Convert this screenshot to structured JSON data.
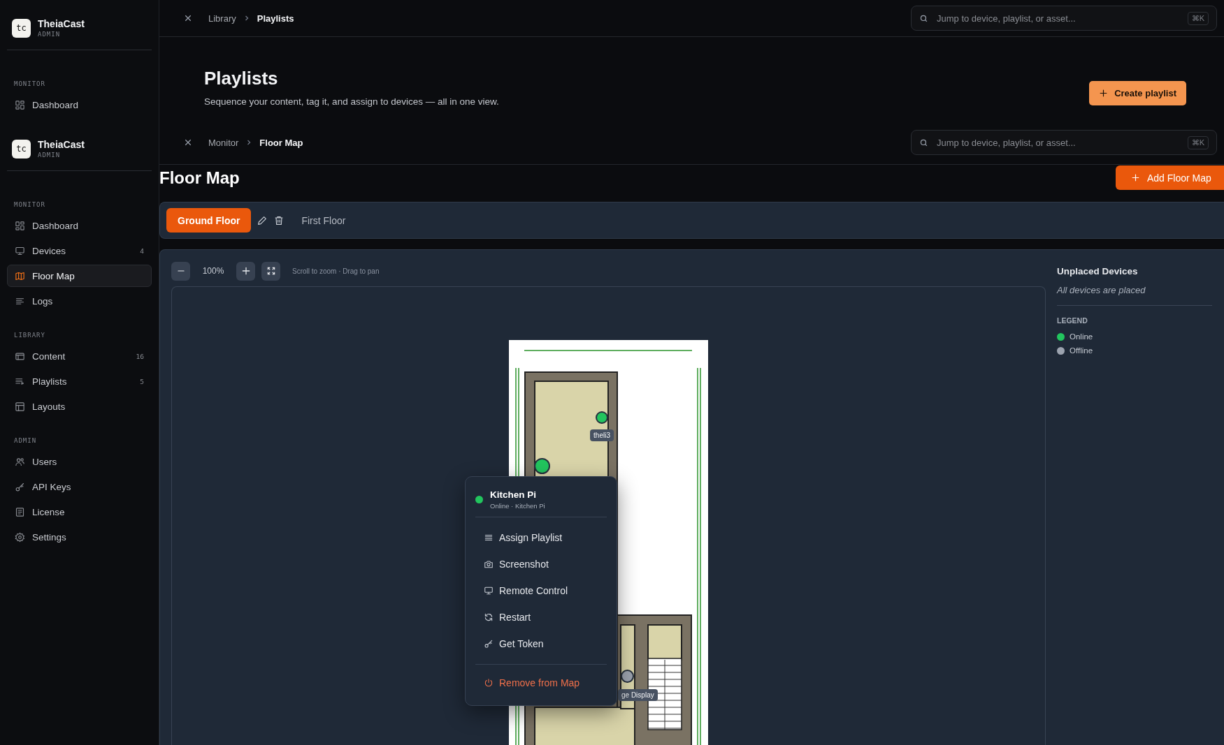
{
  "back_page": {
    "brand": {
      "logo": "tc",
      "name": "TheiaCast",
      "role": "ADMIN"
    },
    "sidebar": [
      {
        "title": "MONITOR",
        "items": [
          {
            "label": "Dashboard",
            "selected": false
          }
        ]
      }
    ],
    "breadcrumb": [
      "Library",
      "Playlists"
    ],
    "search": {
      "placeholder": "Jump to device, playlist, or asset...",
      "shortcut": "⌘K"
    },
    "title": "Playlists",
    "subtitle": "Sequence your content, tag it, and assign to devices — all in one view.",
    "create_button": "Create playlist"
  },
  "app": {
    "brand": {
      "logo": "tc",
      "name": "TheiaCast",
      "role": "ADMIN"
    },
    "sidebar": [
      {
        "title": "MONITOR",
        "items": [
          {
            "label": "Dashboard",
            "selected": false
          },
          {
            "label": "Devices",
            "count": "4",
            "selected": false
          },
          {
            "label": "Floor Map",
            "selected": true
          },
          {
            "label": "Logs",
            "selected": false
          }
        ]
      },
      {
        "title": "LIBRARY",
        "items": [
          {
            "label": "Content",
            "count": "16",
            "selected": false
          },
          {
            "label": "Playlists",
            "count": "5",
            "selected": false
          },
          {
            "label": "Layouts",
            "selected": false
          }
        ]
      },
      {
        "title": "ADMIN",
        "items": [
          {
            "label": "Users",
            "selected": false
          },
          {
            "label": "API Keys",
            "selected": false
          },
          {
            "label": "License",
            "selected": false
          },
          {
            "label": "Settings",
            "selected": false
          }
        ]
      }
    ],
    "breadcrumb": [
      "Monitor",
      "Floor Map"
    ],
    "search": {
      "placeholder": "Jump to device, playlist, or asset...",
      "shortcut": "⌘K"
    },
    "title": "Floor Map",
    "add_button": "Add Floor Map",
    "floors": [
      {
        "label": "Ground Floor",
        "selected": true
      },
      {
        "label": "First Floor",
        "selected": false
      }
    ],
    "zoom": {
      "level_text": "100%",
      "hint": "Scroll to zoom · Drag to pan"
    },
    "map": {
      "devices": [
        {
          "label": "theli3",
          "online": true
        },
        {
          "online": true
        },
        {
          "label": "ge Display",
          "online": false
        }
      ]
    },
    "popup": {
      "name": "Kitchen Pi",
      "online": true,
      "subtitle": "Online · Kitchen Pi",
      "items": [
        {
          "label": "Assign Playlist",
          "kind": "action"
        },
        {
          "label": "Screenshot",
          "kind": "action"
        },
        {
          "label": "Remote Control",
          "kind": "action"
        },
        {
          "label": "Restart",
          "kind": "action"
        },
        {
          "label": "Get Token",
          "kind": "action"
        },
        {
          "label": "Remove from Map",
          "kind": "danger"
        }
      ]
    },
    "unplaced": {
      "title": "Unplaced Devices",
      "empty_text": "All devices are placed"
    },
    "legend": {
      "title": "LEGEND",
      "items": [
        {
          "label": "Online",
          "color": "#22c55e"
        },
        {
          "label": "Offline",
          "color": "#9ca3af"
        }
      ]
    }
  }
}
